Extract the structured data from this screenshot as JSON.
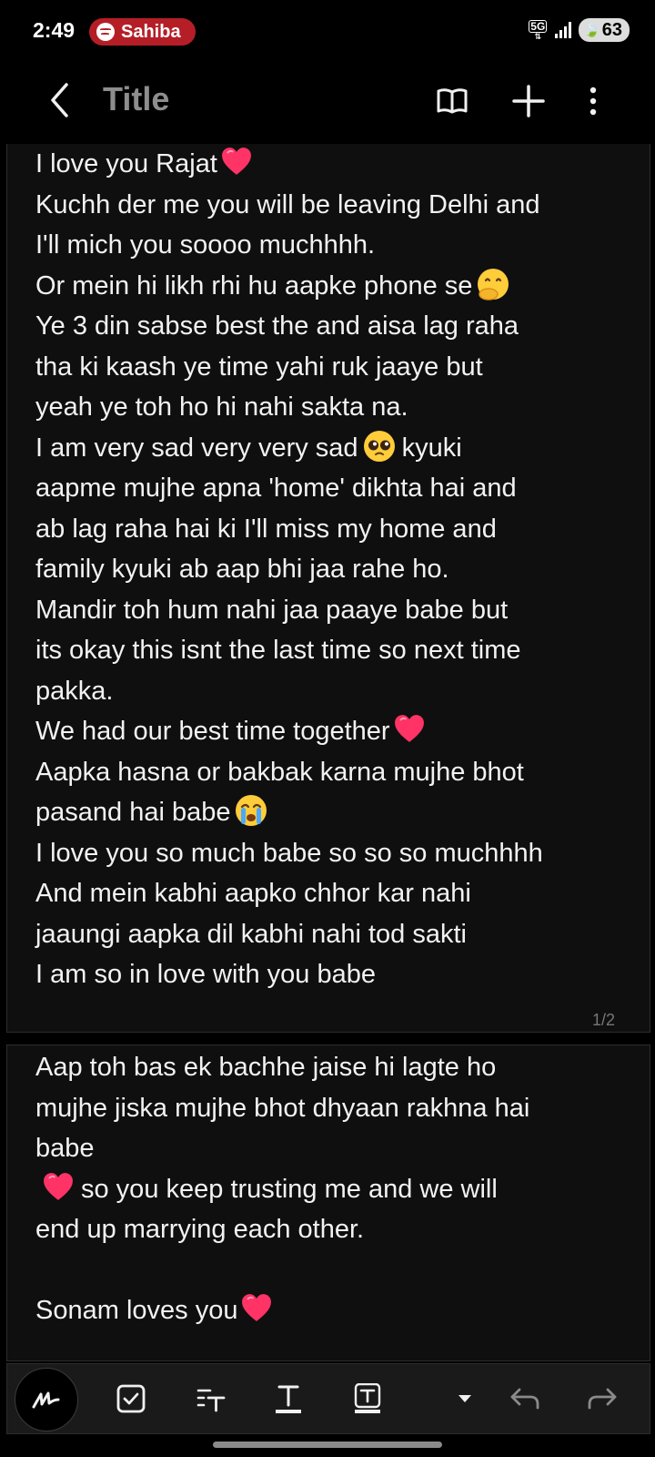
{
  "status_bar": {
    "time": "2:49",
    "media_label": "Sahiba",
    "network": "5G",
    "battery": "63"
  },
  "app_bar": {
    "title": "Title"
  },
  "note": {
    "page1": {
      "lines": [
        "I love you Rajat",
        "Kuchh der me you will be leaving Delhi and",
        "I'll mich you soooo muchhhh.",
        "Or mein hi likh rhi hu aapke phone se",
        "Ye 3 din sabse best the and aisa lag raha",
        "tha ki kaash ye time yahi ruk jaaye but",
        "yeah ye toh ho hi nahi sakta na.",
        "I am very sad very very sad",
        "aapme mujhe apna 'home' dikhta hai and",
        "ab lag raha hai ki I'll miss my home and",
        "family kyuki ab aap bhi jaa rahe ho.",
        "Mandir toh hum nahi jaa paaye babe but",
        "its okay this isnt the last time so next time",
        "pakka.",
        "We had our best time together",
        "Aapka hasna or bakbak karna mujhe bhot",
        "pasand hai babe",
        "I love you so much babe so so so muchhhh",
        "And mein kabhi aapko chhor kar nahi",
        "jaaungi aapka dil kabhi nahi tod sakti",
        "I am so in love with you babe"
      ],
      "line8_suffix": "kyuki",
      "page_number": "1/2"
    },
    "page2": {
      "lines": [
        "Aap toh bas ek bachhe jaise hi lagte ho",
        "mujhe jiska mujhe bhot dhyaan rakhna hai",
        "babe",
        "so you keep trusting me and we will",
        "end up marrying each other.",
        "",
        "Sonam loves you"
      ]
    }
  },
  "icons": {
    "back": "chevron-left-icon",
    "reading_mode": "book-icon",
    "add": "plus-icon",
    "more": "more-vertical-icon",
    "pen": "handwriting-icon",
    "checkbox": "checkbox-icon",
    "text_style": "text-format-icon",
    "text_color": "text-color-icon",
    "text_highlight": "text-highlight-icon",
    "expand": "caret-down-icon",
    "undo": "undo-icon",
    "redo": "redo-icon"
  },
  "colors": {
    "background": "#000000",
    "page": "#0f0f10",
    "title": "#8d8d8d",
    "heart": "#ff3366",
    "media_pill": "#b51e27"
  }
}
